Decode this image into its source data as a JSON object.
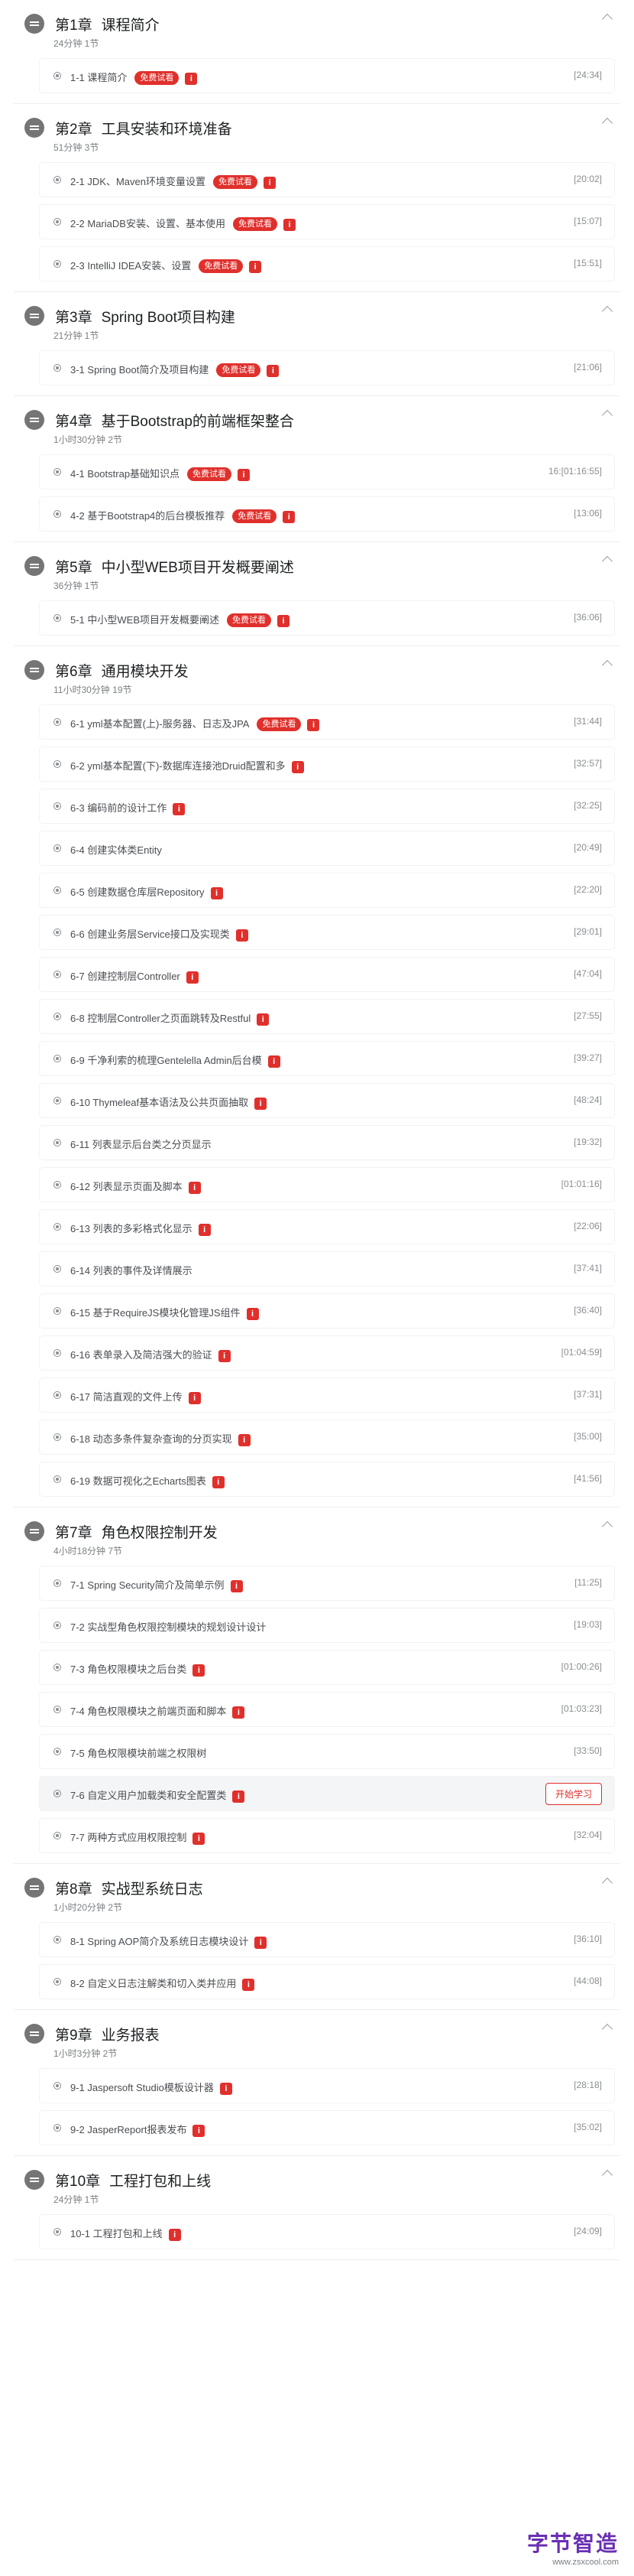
{
  "labels": {
    "free": "免费试看",
    "lock": "i",
    "start": "开始学习"
  },
  "chapters": [
    {
      "no": "第1章",
      "title": "课程简介",
      "meta": "24分钟 1节",
      "lessons": [
        {
          "title": "1-1 课程简介",
          "free": true,
          "lock": true,
          "duration": "[24:34]"
        }
      ]
    },
    {
      "no": "第2章",
      "title": "工具安装和环境准备",
      "meta": "51分钟 3节",
      "lessons": [
        {
          "title": "2-1 JDK、Maven环境变量设置",
          "free": true,
          "lock": true,
          "duration": "[20:02]"
        },
        {
          "title": "2-2 MariaDB安装、设置、基本使用",
          "free": true,
          "lock": true,
          "duration": "[15:07]"
        },
        {
          "title": "2-3 IntelliJ IDEA安装、设置",
          "free": true,
          "lock": true,
          "duration": "[15:51]"
        }
      ]
    },
    {
      "no": "第3章",
      "title": "Spring Boot项目构建",
      "meta": "21分钟 1节",
      "lessons": [
        {
          "title": "3-1 Spring Boot简介及项目构建",
          "free": true,
          "lock": true,
          "duration": "[21:06]"
        }
      ]
    },
    {
      "no": "第4章",
      "title": "基于Bootstrap的前端框架整合",
      "meta": "1小时30分钟 2节",
      "lessons": [
        {
          "title": "4-1 Bootstrap基础知识点",
          "free": true,
          "lock": true,
          "duration": "16:[01:16:55]"
        },
        {
          "title": "4-2 基于Bootstrap4的后台模板推荐",
          "free": true,
          "lock": true,
          "duration": "[13:06]"
        }
      ]
    },
    {
      "no": "第5章",
      "title": "中小型WEB项目开发概要阐述",
      "meta": "36分钟 1节",
      "lessons": [
        {
          "title": "5-1 中小型WEB项目开发概要阐述",
          "free": true,
          "lock": true,
          "duration": "[36:06]"
        }
      ]
    },
    {
      "no": "第6章",
      "title": "通用模块开发",
      "meta": "11小时30分钟 19节",
      "lessons": [
        {
          "title": "6-1 yml基本配置(上)-服务器、日志及JPA",
          "free": true,
          "lock": true,
          "duration": "[31:44]"
        },
        {
          "title": "6-2 yml基本配置(下)-数据库连接池Druid配置和多",
          "free": false,
          "lock": true,
          "duration": "[32:57]"
        },
        {
          "title": "6-3 编码前的设计工作",
          "free": false,
          "lock": true,
          "duration": "[32:25]"
        },
        {
          "title": "6-4 创建实体类Entity",
          "free": false,
          "lock": false,
          "duration": "[20:49]"
        },
        {
          "title": "6-5 创建数据仓库层Repository",
          "free": false,
          "lock": true,
          "duration": "[22:20]"
        },
        {
          "title": "6-6 创建业务层Service接口及实现类",
          "free": false,
          "lock": true,
          "duration": "[29:01]"
        },
        {
          "title": "6-7 创建控制层Controller",
          "free": false,
          "lock": true,
          "duration": "[47:04]"
        },
        {
          "title": "6-8 控制层Controller之页面跳转及Restful",
          "free": false,
          "lock": true,
          "duration": "[27:55]"
        },
        {
          "title": "6-9 千净利索的梳理Gentelella Admin后台模",
          "free": false,
          "lock": true,
          "duration": "[39:27]"
        },
        {
          "title": "6-10 Thymeleaf基本语法及公共页面抽取",
          "free": false,
          "lock": true,
          "duration": "[48:24]"
        },
        {
          "title": "6-11 列表显示后台类之分页显示",
          "free": false,
          "lock": false,
          "duration": "[19:32]"
        },
        {
          "title": "6-12 列表显示页面及脚本",
          "free": false,
          "lock": true,
          "duration": "[01:01:16]"
        },
        {
          "title": "6-13 列表的多彩格式化显示",
          "free": false,
          "lock": true,
          "duration": "[22:06]"
        },
        {
          "title": "6-14 列表的事件及详情展示",
          "free": false,
          "lock": false,
          "duration": "[37:41]"
        },
        {
          "title": "6-15 基于RequireJS模块化管理JS组件",
          "free": false,
          "lock": true,
          "duration": "[36:40]"
        },
        {
          "title": "6-16 表单录入及简洁强大的验证",
          "free": false,
          "lock": true,
          "duration": "[01:04:59]"
        },
        {
          "title": "6-17 简洁直观的文件上传",
          "free": false,
          "lock": true,
          "duration": "[37:31]"
        },
        {
          "title": "6-18 动态多条件复杂查询的分页实现",
          "free": false,
          "lock": true,
          "duration": "[35:00]"
        },
        {
          "title": "6-19 数据可视化之Echarts图表",
          "free": false,
          "lock": true,
          "duration": "[41:56]"
        }
      ]
    },
    {
      "no": "第7章",
      "title": "角色权限控制开发",
      "meta": "4小时18分钟 7节",
      "lessons": [
        {
          "title": "7-1 Spring Security简介及简单示例",
          "free": false,
          "lock": true,
          "duration": "[11:25]"
        },
        {
          "title": "7-2 实战型角色权限控制模块的规划设计设计",
          "free": false,
          "lock": false,
          "duration": "[19:03]"
        },
        {
          "title": "7-3 角色权限模块之后台类",
          "free": false,
          "lock": true,
          "duration": "[01:00:26]"
        },
        {
          "title": "7-4 角色权限模块之前端页面和脚本",
          "free": false,
          "lock": true,
          "duration": "[01:03:23]"
        },
        {
          "title": "7-5 角色权限模块前端之权限树",
          "free": false,
          "lock": false,
          "duration": "[33:50]"
        },
        {
          "title": "7-6 自定义用户加载类和安全配置类",
          "free": false,
          "lock": true,
          "duration": "",
          "active": true
        },
        {
          "title": "7-7 两种方式应用权限控制",
          "free": false,
          "lock": true,
          "duration": "[32:04]"
        }
      ]
    },
    {
      "no": "第8章",
      "title": "实战型系统日志",
      "meta": "1小时20分钟 2节",
      "lessons": [
        {
          "title": "8-1 Spring AOP简介及系统日志模块设计",
          "free": false,
          "lock": true,
          "duration": "[36:10]"
        },
        {
          "title": "8-2 自定义日志注解类和切入类并应用",
          "free": false,
          "lock": true,
          "duration": "[44:08]"
        }
      ]
    },
    {
      "no": "第9章",
      "title": "业务报表",
      "meta": "1小时3分钟 2节",
      "lessons": [
        {
          "title": "9-1 Jaspersoft Studio模板设计器",
          "free": false,
          "lock": true,
          "duration": "[28:18]"
        },
        {
          "title": "9-2 JasperReport报表发布",
          "free": false,
          "lock": true,
          "duration": "[35:02]"
        }
      ]
    },
    {
      "no": "第10章",
      "title": "工程打包和上线",
      "meta": "24分钟 1节",
      "lessons": [
        {
          "title": "10-1 工程打包和上线",
          "free": false,
          "lock": true,
          "duration": "[24:09]"
        }
      ]
    }
  ],
  "watermark": {
    "main": "字节智造",
    "sub": "www.zsxcool.com"
  }
}
